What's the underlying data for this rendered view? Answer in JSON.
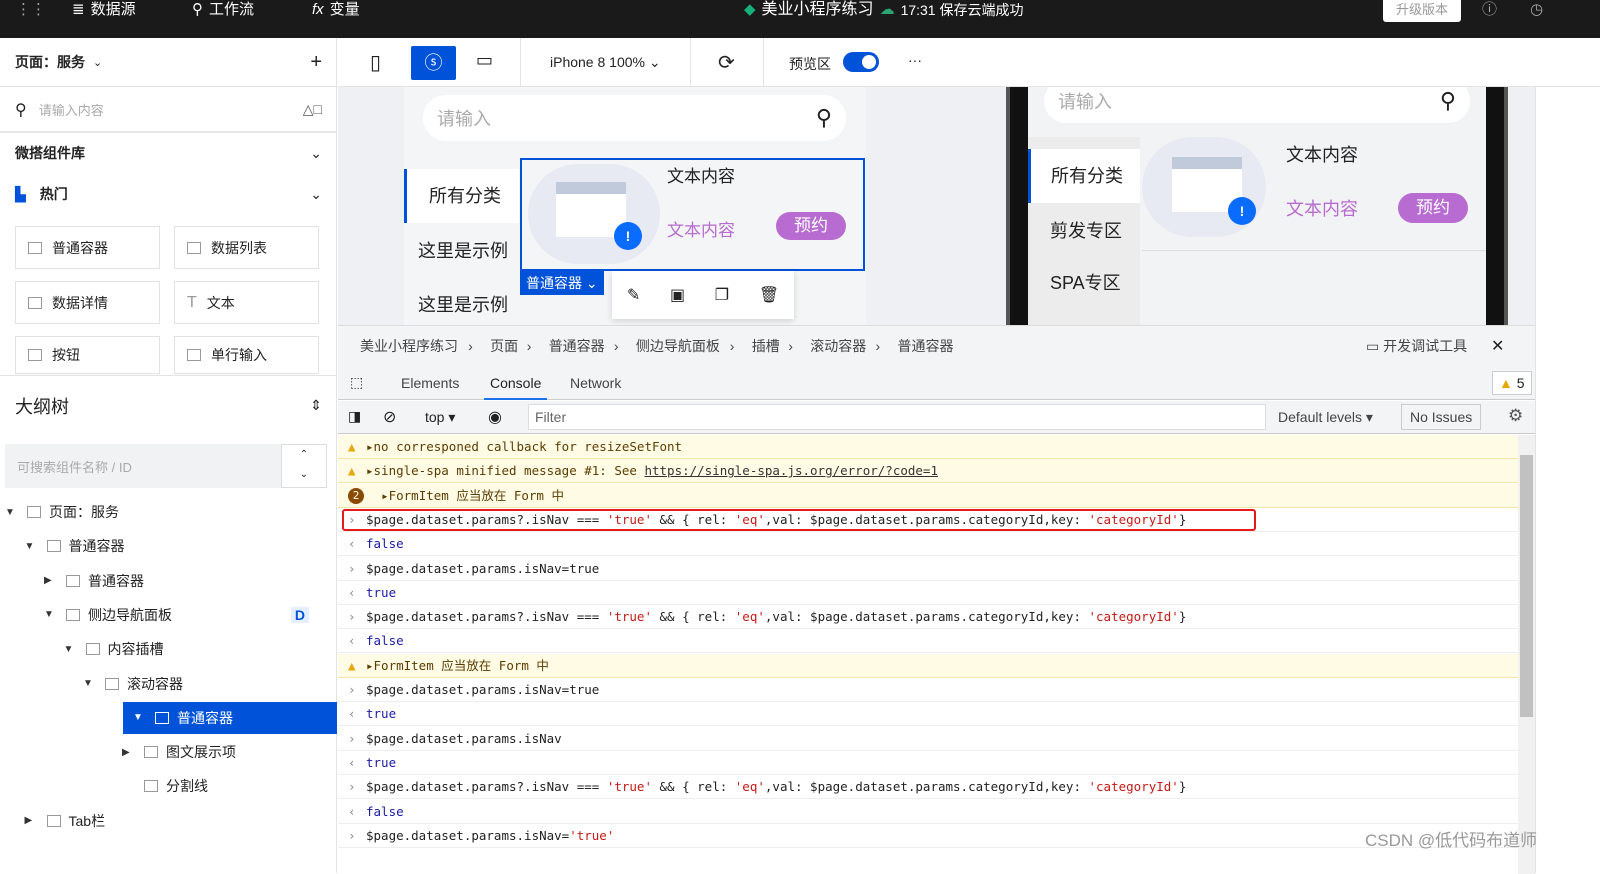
{
  "topbar": {
    "datasource": "数据源",
    "workflow": "工作流",
    "variable": "变量",
    "app_title": "美业小程序练习",
    "save_status": "17:31 保存云端成功",
    "upgrade": "升级版本"
  },
  "left": {
    "page_selector": "页面：服务",
    "search_placeholder": "请输入内容",
    "library": "微搭组件库",
    "hot": "热门",
    "components": [
      "普通容器",
      "数据列表",
      "数据详情",
      "文本",
      "按钮",
      "单行输入"
    ],
    "outline_title": "大纲树",
    "outline_search_placeholder": "可搜索组件名称 / ID",
    "tree": [
      {
        "label": "页面：服务",
        "depth": 0,
        "open": true
      },
      {
        "label": "普通容器",
        "depth": 1,
        "open": true
      },
      {
        "label": "普通容器",
        "depth": 2,
        "open": false
      },
      {
        "label": "侧边导航面板",
        "depth": 2,
        "open": true,
        "badge": "D"
      },
      {
        "label": "内容插槽",
        "depth": 3,
        "open": true
      },
      {
        "label": "滚动容器",
        "depth": 4,
        "open": true
      },
      {
        "label": "普通容器",
        "depth": 5,
        "open": true,
        "selected": true
      },
      {
        "label": "图文展示项",
        "depth": 6,
        "open": false
      },
      {
        "label": "分割线",
        "depth": 6,
        "leaf": true
      },
      {
        "label": "Tab栏",
        "depth": 1,
        "open": false
      }
    ]
  },
  "toolbar": {
    "device": "iPhone 8 100%",
    "preview_label": "预览区",
    "preview_on": true,
    "more": "···"
  },
  "preview": {
    "search_placeholder": "请输入",
    "categories": [
      "所有分类",
      "这里是示例",
      "这里是示例"
    ],
    "right_categories": [
      "所有分类",
      "剪发专区",
      "SPA专区"
    ],
    "item_title": "文本内容",
    "item_sub": "文本内容",
    "book": "预约",
    "selected_tag": "普通容器"
  },
  "devtools": {
    "breadcrumb": [
      "美业小程序练习",
      "页面",
      "普通容器",
      "侧边导航面板",
      "插槽",
      "滚动容器",
      "普通容器"
    ],
    "title": "开发调试工具",
    "tabs": [
      "Elements",
      "Console",
      "Network"
    ],
    "active_tab": "Console",
    "warn_count": "5",
    "context": "top",
    "filter_placeholder": "Filter",
    "levels": "Default levels",
    "issues": "No Issues",
    "lines": [
      {
        "type": "warn",
        "text": "no corresponed callback for resizeSetFont"
      },
      {
        "type": "warn",
        "text": "single-spa minified message #1: See ",
        "link": "https://single-spa.js.org/error/?code=1"
      },
      {
        "type": "warn2",
        "count": "2",
        "text": "FormItem 应当放在 Form 中"
      },
      {
        "type": "in",
        "text": "$page.dataset.params?.isNav === 'true' && { rel: 'eq',val: $page.dataset.params.categoryId,key: 'categoryId'}",
        "highlight": true
      },
      {
        "type": "out",
        "text": "false"
      },
      {
        "type": "in",
        "text": "$page.dataset.params.isNav=true"
      },
      {
        "type": "out",
        "text": "true"
      },
      {
        "type": "in",
        "text": "$page.dataset.params?.isNav === 'true' && { rel: 'eq',val: $page.dataset.params.categoryId,key: 'categoryId'}"
      },
      {
        "type": "out",
        "text": "false"
      },
      {
        "type": "warn",
        "text": "FormItem 应当放在 Form 中"
      },
      {
        "type": "in",
        "text": "$page.dataset.params.isNav=true"
      },
      {
        "type": "out",
        "text": "true"
      },
      {
        "type": "in",
        "text": "$page.dataset.params.isNav"
      },
      {
        "type": "out",
        "text": "true"
      },
      {
        "type": "in",
        "text": "$page.dataset.params?.isNav === 'true' && { rel: 'eq',val: $page.dataset.params.categoryId,key: 'categoryId'}"
      },
      {
        "type": "out",
        "text": "false"
      },
      {
        "type": "in",
        "text": "$page.dataset.params.isNav='true'"
      }
    ]
  },
  "watermark": "CSDN @低代码布道师",
  "colors": {
    "accent": "#0052d9",
    "purple": "#b86bd0",
    "topbar": "#1a1a1a"
  }
}
